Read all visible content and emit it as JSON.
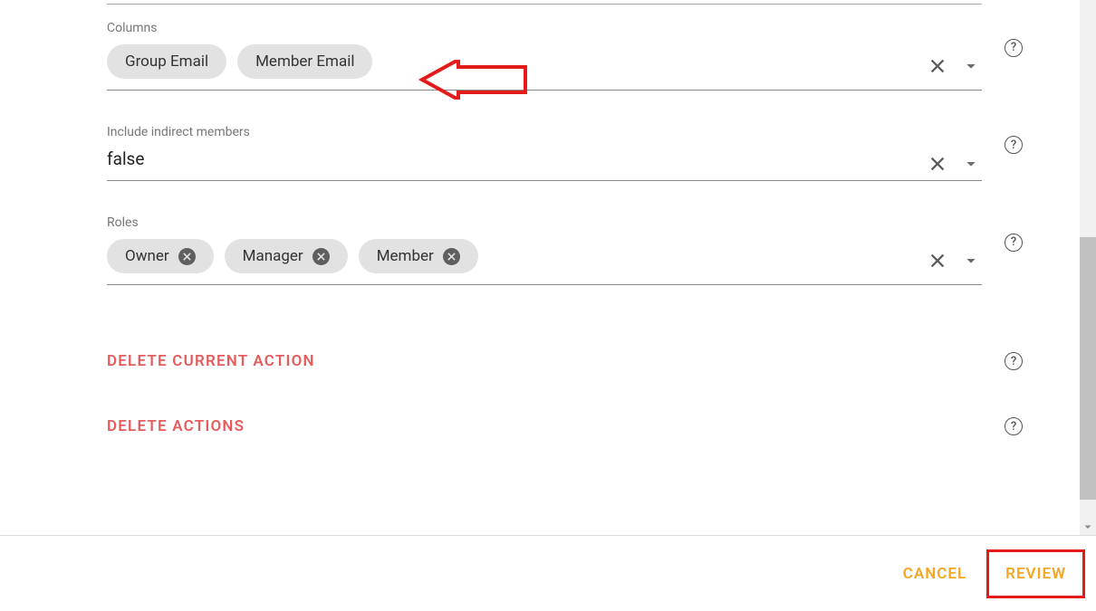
{
  "sections": {
    "columns": {
      "label": "Columns"
    },
    "indirect": {
      "label": "Include indirect members",
      "value": "false"
    },
    "roles": {
      "label": "Roles"
    }
  },
  "columns_chips": [
    {
      "label": "Group Email"
    },
    {
      "label": "Member Email"
    }
  ],
  "roles_chips": [
    {
      "label": "Owner"
    },
    {
      "label": "Manager"
    },
    {
      "label": "Member"
    }
  ],
  "actions": {
    "delete_current": "DELETE CURRENT ACTION",
    "delete_all": "DELETE ACTIONS"
  },
  "footer": {
    "cancel": "CANCEL",
    "review": "REVIEW"
  },
  "glyphs": {
    "help": "?"
  }
}
